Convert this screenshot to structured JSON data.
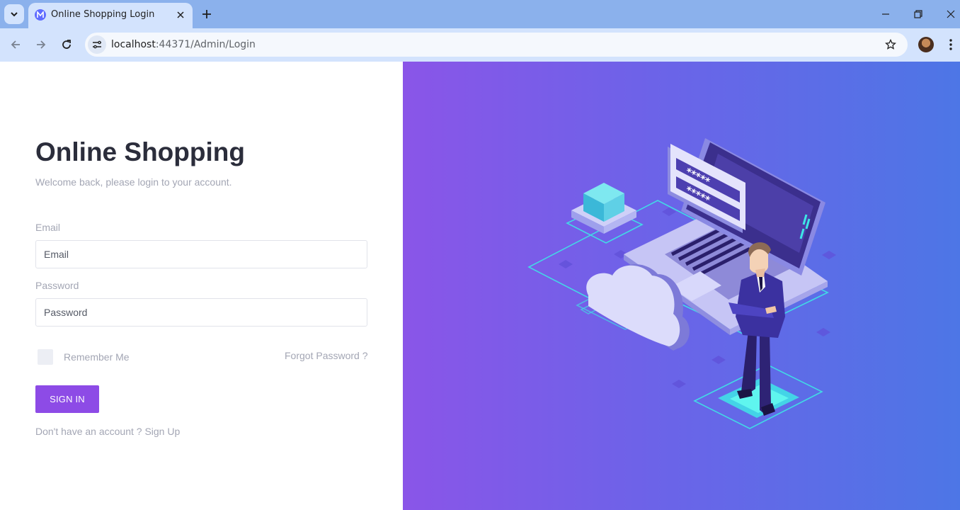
{
  "browser": {
    "tab_title": "Online Shopping Login",
    "url_host": "localhost",
    "url_path": ":44371/Admin/Login"
  },
  "login": {
    "title": "Online Shopping",
    "subtitle": "Welcome back, please login to your account.",
    "email_label": "Email",
    "email_placeholder": "Email",
    "password_label": "Password",
    "password_placeholder": "Password",
    "remember_label": "Remember Me",
    "forgot_label": "Forgot Password ?",
    "signin_label": "SIGN IN",
    "signup_label": "Don't have an account ? Sign Up"
  },
  "illustration": {
    "password_mask_1": "*****",
    "password_mask_2": "*****"
  },
  "colors": {
    "accent": "#8d4be6",
    "gradient_start": "#8a55e8",
    "gradient_end": "#4d76e6"
  },
  "icons": {
    "tab_menu": "chevron-down-icon",
    "favicon": "app-logo-icon",
    "close_tab": "close-icon",
    "new_tab": "plus-icon",
    "back": "arrow-left-icon",
    "forward": "arrow-right-icon",
    "reload": "reload-icon",
    "site_info": "tune-icon",
    "bookmark": "star-icon",
    "menu": "kebab-menu-icon"
  }
}
